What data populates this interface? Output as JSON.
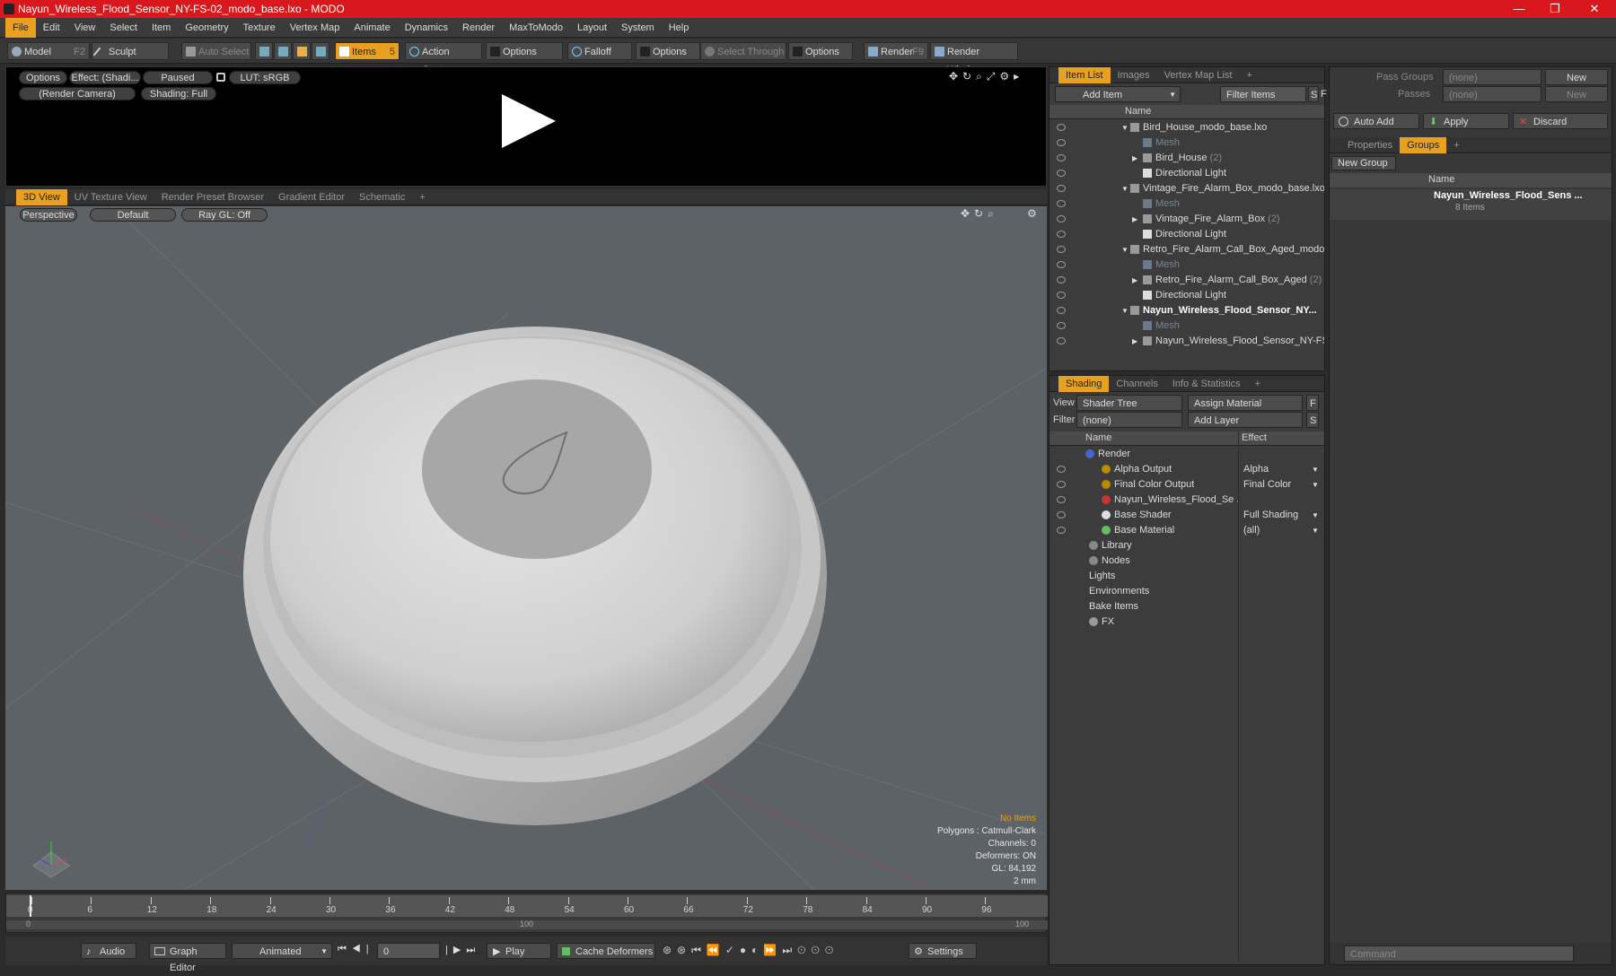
{
  "window": {
    "title": "Nayun_Wireless_Flood_Sensor_NY-FS-02_modo_base.lxo - MODO",
    "min": "—",
    "max": "❐",
    "close": "✕"
  },
  "menu": [
    "File",
    "Edit",
    "View",
    "Select",
    "Item",
    "Geometry",
    "Texture",
    "Vertex Map",
    "Animate",
    "Dynamics",
    "Render",
    "MaxToModo",
    "Layout",
    "System",
    "Help"
  ],
  "toolbar": {
    "model": "Model",
    "model_key": "F2",
    "sculpt": "Sculpt",
    "auto_select": "Auto Select",
    "items": "Items",
    "items_key": "5",
    "action_center": "Action Center",
    "options1": "Options",
    "falloff": "Falloff",
    "options2": "Options",
    "select_through": "Select Through",
    "options3": "Options",
    "render": "Render",
    "render_key": "F9",
    "render_window": "Render Window"
  },
  "render_preview": {
    "options": "Options",
    "effect": "Effect: (Shadi...",
    "paused": "Paused",
    "lut": "LUT: sRGB",
    "camera": "(Render Camera)",
    "shading": "Shading: Full"
  },
  "viewport_tabs": [
    "3D View",
    "UV Texture View",
    "Render Preset Browser",
    "Gradient Editor",
    "Schematic",
    "+"
  ],
  "viewport": {
    "perspective": "Perspective",
    "default": "Default",
    "raygl": "Ray GL: Off",
    "hud": {
      "items": "No Items",
      "polygons": "Polygons : Catmull-Clark",
      "channels": "Channels: 0",
      "deformers": "Deformers: ON",
      "gl": "GL: 84,192",
      "scale": "2 mm"
    }
  },
  "timeline": {
    "ticks": [
      "0",
      "6",
      "12",
      "18",
      "24",
      "30",
      "36",
      "42",
      "48",
      "54",
      "60",
      "66",
      "72",
      "78",
      "84",
      "90",
      "96"
    ],
    "range_start": "0",
    "range_mid": "100",
    "range_end": "100"
  },
  "bottombar": {
    "audio": "Audio",
    "graph_editor": "Graph Editor",
    "animated": "Animated",
    "frame": "0",
    "play": "Play",
    "cache": "Cache Deformers",
    "settings": "Settings"
  },
  "item_list": {
    "tabs": [
      "Item List",
      "Images",
      "Vertex Map List",
      "+"
    ],
    "add_item": "Add Item",
    "filter": "Filter Items",
    "s": "S",
    "f": "F",
    "col_name": "Name",
    "rows": [
      {
        "label": "Bird_House_modo_base.lxo",
        "kind": "scene"
      },
      {
        "label": "Mesh",
        "kind": "mesh"
      },
      {
        "label": "Bird_House",
        "count": "(2)",
        "kind": "group"
      },
      {
        "label": "Directional Light",
        "kind": "light"
      },
      {
        "label": "Vintage_Fire_Alarm_Box_modo_base.lxo",
        "kind": "scene"
      },
      {
        "label": "Mesh",
        "kind": "mesh"
      },
      {
        "label": "Vintage_Fire_Alarm_Box",
        "count": "(2)",
        "kind": "group"
      },
      {
        "label": "Directional Light",
        "kind": "light"
      },
      {
        "label": "Retro_Fire_Alarm_Call_Box_Aged_modo...",
        "kind": "scene"
      },
      {
        "label": "Mesh",
        "kind": "mesh"
      },
      {
        "label": "Retro_Fire_Alarm_Call_Box_Aged",
        "count": "(2)",
        "kind": "group"
      },
      {
        "label": "Directional Light",
        "kind": "light"
      },
      {
        "label": "Nayun_Wireless_Flood_Sensor_NY...",
        "kind": "scene-bold"
      },
      {
        "label": "Mesh",
        "kind": "mesh"
      },
      {
        "label": "Nayun_Wireless_Flood_Sensor_NY-FS...",
        "kind": "group"
      }
    ]
  },
  "shading": {
    "tabs": [
      "Shading",
      "Channels",
      "Info & Statistics",
      "+"
    ],
    "view_label": "View",
    "view_value": "Shader Tree",
    "assign": "Assign Material",
    "f": "F",
    "filter_label": "Filter",
    "filter_value": "(none)",
    "add_layer": "Add Layer",
    "s": "S",
    "col_name": "Name",
    "col_effect": "Effect",
    "rows": [
      {
        "label": "Render",
        "effect": ""
      },
      {
        "label": "Alpha Output",
        "effect": "Alpha"
      },
      {
        "label": "Final Color Output",
        "effect": "Final Color"
      },
      {
        "label": "Nayun_Wireless_Flood_Se ...",
        "effect": ""
      },
      {
        "label": "Base Shader",
        "effect": "Full Shading"
      },
      {
        "label": "Base Material",
        "effect": "(all)"
      },
      {
        "label": "Library",
        "effect": ""
      },
      {
        "label": "Nodes",
        "effect": ""
      },
      {
        "label": "Lights",
        "effect": ""
      },
      {
        "label": "Environments",
        "effect": ""
      },
      {
        "label": "Bake Items",
        "effect": ""
      },
      {
        "label": "FX",
        "effect": ""
      }
    ]
  },
  "right_panel": {
    "pass_groups": "Pass Groups",
    "pass_value": "(none)",
    "new1": "New",
    "passes": "Passes",
    "passes_value": "(none)",
    "new2": "New",
    "auto_add": "Auto Add",
    "apply": "Apply",
    "discard": "Discard",
    "tabs": [
      "Properties",
      "Groups",
      "+"
    ],
    "new_group": "New Group",
    "col_name": "Name",
    "group_name": "Nayun_Wireless_Flood_Sens ...",
    "group_count": "8 Items",
    "command": "Command"
  }
}
